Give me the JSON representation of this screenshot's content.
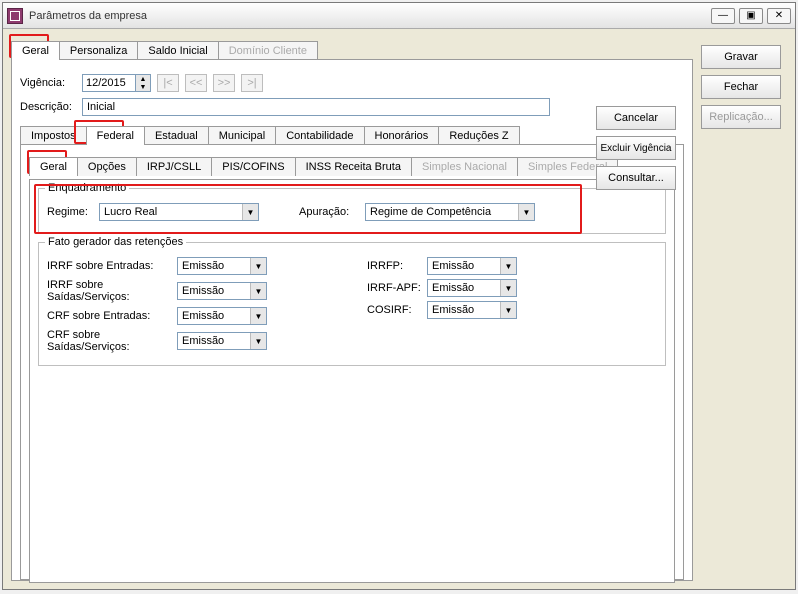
{
  "window": {
    "title": "Parâmetros da empresa"
  },
  "winbtns": {
    "min": "—",
    "max": "▣",
    "close": "✕"
  },
  "top_tabs": [
    {
      "label": "Geral",
      "active": true
    },
    {
      "label": "Personaliza"
    },
    {
      "label": "Saldo Inicial"
    },
    {
      "label": "Domínio Cliente",
      "disabled": true
    }
  ],
  "vigencia": {
    "label": "Vigência:",
    "value": "12/2015",
    "nav": [
      "|<",
      "<<",
      ">>",
      ">|"
    ]
  },
  "descricao": {
    "label": "Descrição:",
    "value": "Inicial"
  },
  "tax_tabs": [
    {
      "label": "Impostos"
    },
    {
      "label": "Federal",
      "active": true
    },
    {
      "label": "Estadual"
    },
    {
      "label": "Municipal"
    },
    {
      "label": "Contabilidade"
    },
    {
      "label": "Honorários"
    },
    {
      "label": "Reduções Z"
    }
  ],
  "sub_tabs": [
    {
      "label": "Geral",
      "active": true
    },
    {
      "label": "Opções"
    },
    {
      "label": "IRPJ/CSLL"
    },
    {
      "label": "PIS/COFINS"
    },
    {
      "label": "INSS Receita Bruta"
    },
    {
      "label": "Simples Nacional",
      "disabled": true
    },
    {
      "label": "Simples Federal",
      "disabled": true
    }
  ],
  "enq": {
    "title": "Enquadramento",
    "regime_label": "Regime:",
    "regime": "Lucro Real",
    "apuracao_label": "Apuração:",
    "apuracao": "Regime de Competência"
  },
  "ret": {
    "title": "Fato gerador das retenções",
    "irrf_entradas_label": "IRRF sobre Entradas:",
    "irrf_entradas": "Emissão",
    "irrf_saidas_label": "IRRF sobre Saídas/Serviços:",
    "irrf_saidas": "Emissão",
    "crf_entradas_label": "CRF sobre Entradas:",
    "crf_entradas": "Emissão",
    "crf_saidas_label": "CRF sobre Saídas/Serviços:",
    "crf_saidas": "Emissão",
    "irrfp_label": "IRRFP:",
    "irrfp": "Emissão",
    "irrfapf_label": "IRRF-APF:",
    "irrfapf": "Emissão",
    "cosirf_label": "COSIRF:",
    "cosirf": "Emissão"
  },
  "buttons": {
    "cancelar": "Cancelar",
    "excluir": "Excluir Vigência",
    "consultar": "Consultar...",
    "gravar": "Gravar",
    "fechar": "Fechar",
    "replicacao": "Replicação..."
  }
}
